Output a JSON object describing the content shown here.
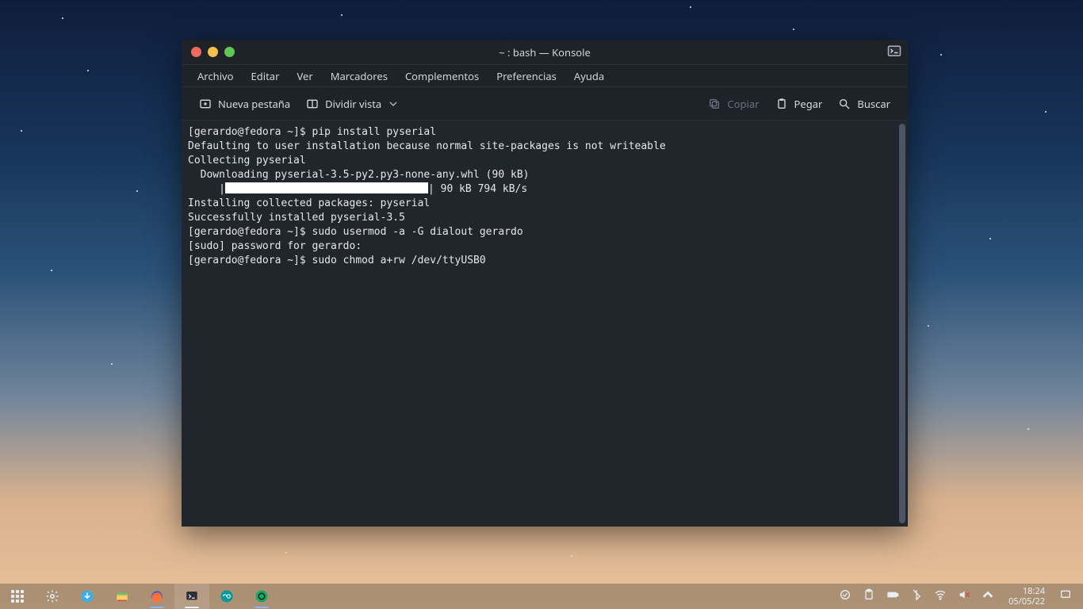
{
  "window": {
    "title": "~ : bash — Konsole"
  },
  "menubar": {
    "archivo": "Archivo",
    "editar": "Editar",
    "ver": "Ver",
    "marcadores": "Marcadores",
    "complementos": "Complementos",
    "preferencias": "Preferencias",
    "ayuda": "Ayuda"
  },
  "toolbar": {
    "new_tab": "Nueva pestaña",
    "split_view": "Dividir vista",
    "copy": "Copiar",
    "paste": "Pegar",
    "search": "Buscar"
  },
  "terminal": {
    "lines": [
      "[gerardo@fedora ~]$ pip install pyserial",
      "Defaulting to user installation because normal site-packages is not writeable",
      "Collecting pyserial",
      "  Downloading pyserial-3.5-py2.py3-none-any.whl (90 kB)"
    ],
    "progress_prefix": "     |",
    "progress_suffix": "| 90 kB 794 kB/s",
    "after_lines": [
      "Installing collected packages: pyserial",
      "Successfully installed pyserial-3.5",
      "[gerardo@fedora ~]$ sudo usermod -a -G dialout gerardo",
      "[sudo] password for gerardo: ",
      "[gerardo@fedora ~]$ sudo chmod a+rw /dev/ttyUSB0"
    ]
  },
  "panel": {
    "time": "18:24",
    "date": "05/05/22"
  }
}
